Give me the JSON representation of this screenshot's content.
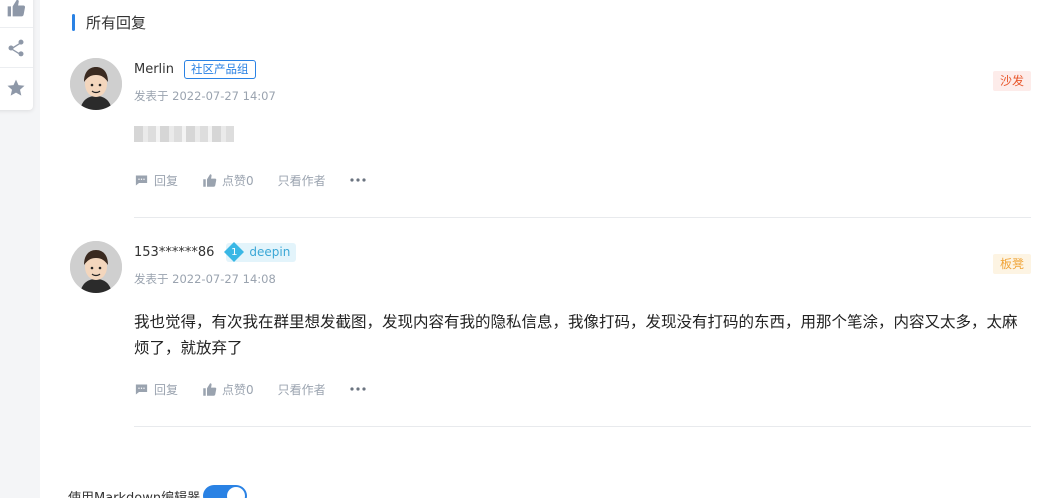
{
  "section": {
    "title": "所有回复"
  },
  "rail": {
    "icons": [
      "thumbs-up-icon",
      "share-icon",
      "star-icon"
    ]
  },
  "replies": [
    {
      "author": "Merlin",
      "badge": "社区产品组",
      "time": "发表于 2022-07-27 14:07",
      "floor": "沙发",
      "content": "",
      "actions": {
        "reply": "回复",
        "like": "点赞0",
        "author_only": "只看作者"
      }
    },
    {
      "author": "153******86",
      "level": "1",
      "level_name": "deepin",
      "time": "发表于 2022-07-27 14:08",
      "floor": "板凳",
      "content": "我也觉得，有次我在群里想发截图，发现内容有我的隐私信息，我像打码，发现没有打码的东西，用那个笔涂，内容又太多，太麻烦了，就放弃了",
      "actions": {
        "reply": "回复",
        "like": "点赞0",
        "author_only": "只看作者"
      }
    }
  ],
  "editor": {
    "markdown_label": "使用Markdown编辑器",
    "markdown_enabled": true
  },
  "colors": {
    "accent": "#2a82e4",
    "sofa": "#e8562a",
    "bench": "#f0a53a",
    "level": "#3ba7d6"
  }
}
